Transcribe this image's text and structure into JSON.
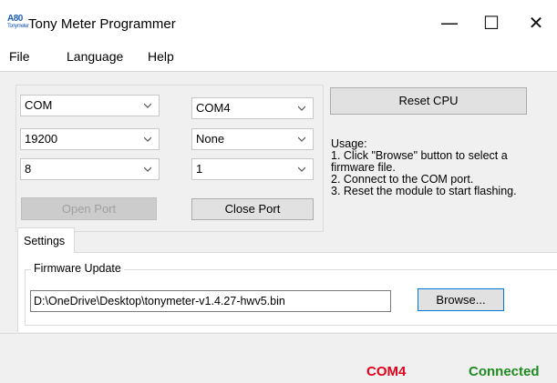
{
  "window": {
    "title": "Tony Meter Programmer",
    "icon_text": "A80",
    "icon_subtext": "Tonymeter",
    "minimize": "—",
    "maximize": "☐",
    "close": "✕"
  },
  "menu": {
    "file": "File",
    "language": "Language",
    "help": "Help"
  },
  "port_settings": {
    "port_type": "COM",
    "port_name": "COM4",
    "baud_rate": "19200",
    "parity": "None",
    "data_bits": "8",
    "stop_bits": "1",
    "open_port_label": "Open Port",
    "close_port_label": "Close Port"
  },
  "reset_cpu_label": "Reset CPU",
  "usage": {
    "heading": "Usage:",
    "line1": "1. Click \"Browse\" button to select a",
    "line1b": "firmware file.",
    "line2": "2. Connect to the COM port.",
    "line3": "3. Reset the module to start flashing."
  },
  "tabs": {
    "settings": "Settings"
  },
  "firmware": {
    "group_label": "Firmware Update",
    "path": "D:\\OneDrive\\Desktop\\tonymeter-v1.4.27-hwv5.bin",
    "browse_label": "Browse..."
  },
  "status": {
    "port": "COM4",
    "port_color": "#e0001b",
    "connection": "Connected",
    "connection_color": "#1f8a1f"
  }
}
